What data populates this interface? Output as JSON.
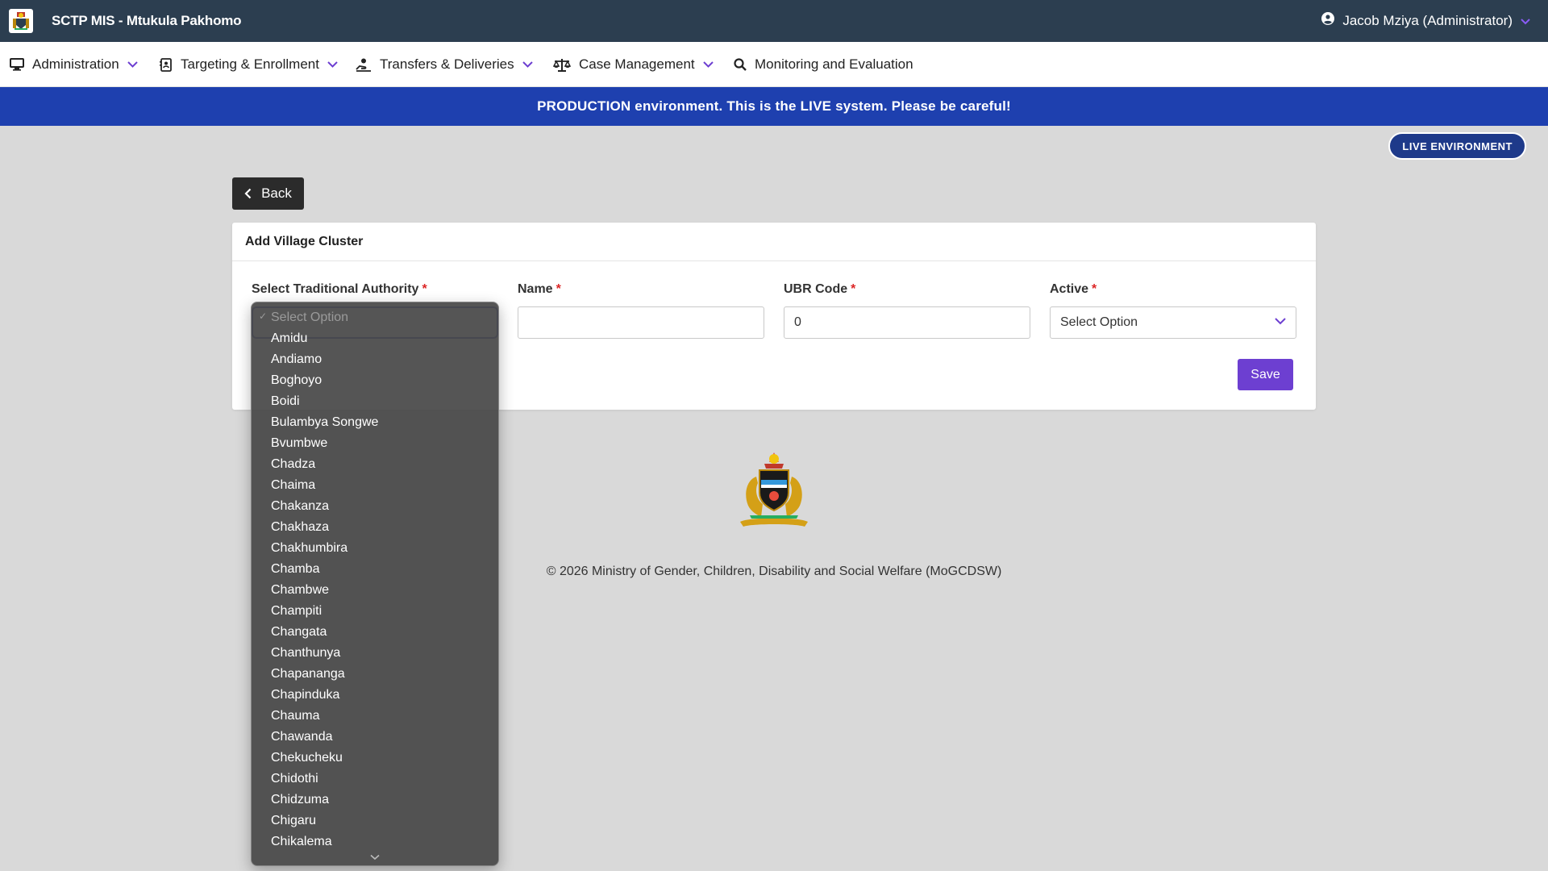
{
  "header": {
    "app_title": "SCTP MIS - Mtukula Pakhomo",
    "user_label": "Jacob Mziya (Administrator)"
  },
  "nav": {
    "items": [
      {
        "label": "Administration"
      },
      {
        "label": "Targeting & Enrollment"
      },
      {
        "label": "Transfers & Deliveries"
      },
      {
        "label": "Case Management"
      },
      {
        "label": "Monitoring and Evaluation"
      }
    ]
  },
  "banner": {
    "text": "PRODUCTION environment. This is the LIVE system. Please be careful!",
    "badge": "LIVE ENVIRONMENT"
  },
  "page": {
    "back_label": "Back",
    "card_title": "Add Village Cluster",
    "save_label": "Save"
  },
  "form": {
    "ta_label": "Select Traditional Authority",
    "name_label": "Name",
    "name_value": "",
    "ubr_label": "UBR Code",
    "ubr_value": "0",
    "active_label": "Active",
    "active_value": "Select Option",
    "required_mark": "*"
  },
  "dropdown": {
    "placeholder": "Select Option",
    "options": [
      "Amidu",
      "Andiamo",
      "Boghoyo",
      "Boidi",
      "Bulambya Songwe",
      "Bvumbwe",
      "Chadza",
      "Chaima",
      "Chakanza",
      "Chakhaza",
      "Chakhumbira",
      "Chamba",
      "Chambwe",
      "Champiti",
      "Changata",
      "Chanthunya",
      "Chapananga",
      "Chapinduka",
      "Chauma",
      "Chawanda",
      "Chekucheku",
      "Chidothi",
      "Chidzuma",
      "Chigaru",
      "Chikalema"
    ]
  },
  "footer": {
    "text": "© 2026 Ministry of Gender, Children, Disability and Social Welfare (MoGCDSW)"
  },
  "colors": {
    "topbar": "#2c3e50",
    "banner": "#1e40af",
    "badge": "#1e3a8a",
    "save_button": "#6d3fd1",
    "required": "#dc2626"
  },
  "icons": {
    "nav": [
      "monitor-icon",
      "id-card-icon",
      "hand-coin-icon",
      "scales-icon",
      "search-icon"
    ],
    "user": "user-circle-icon"
  }
}
